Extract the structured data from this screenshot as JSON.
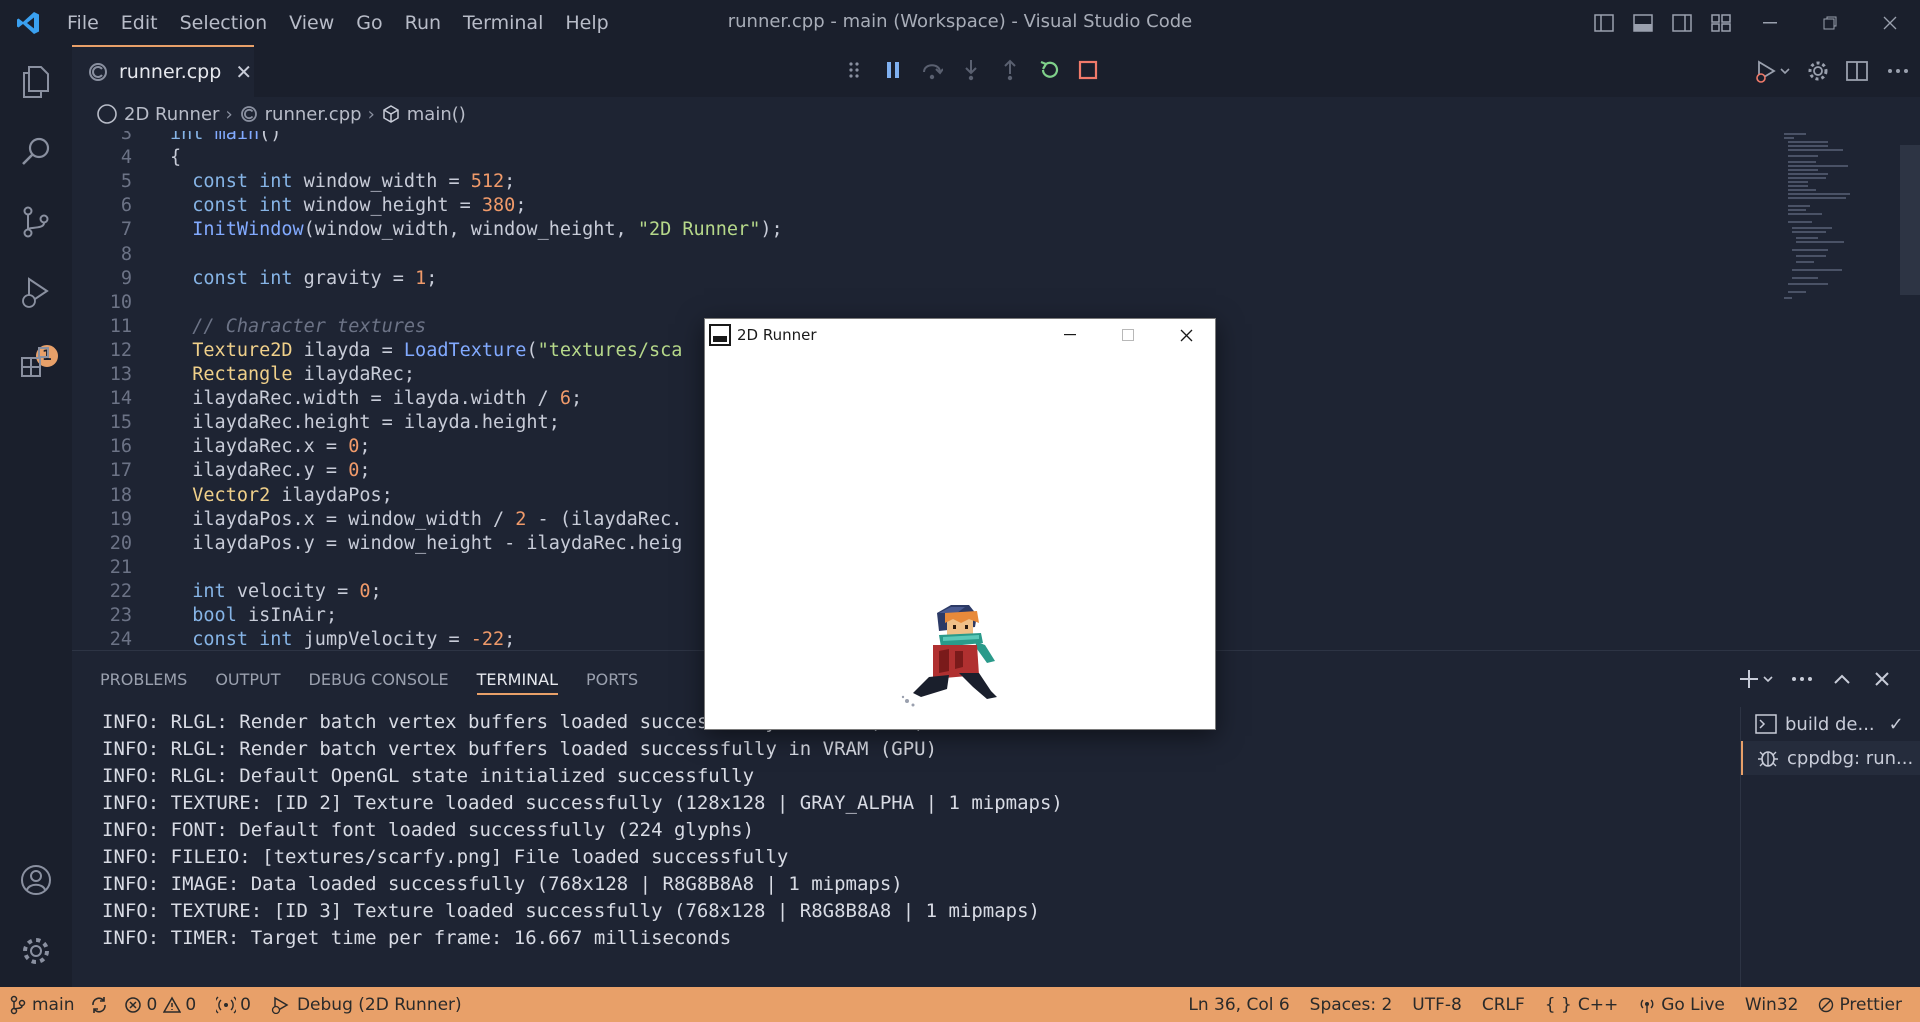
{
  "window_title": "runner.cpp - main (Workspace) - Visual Studio Code",
  "menu": [
    "File",
    "Edit",
    "Selection",
    "View",
    "Go",
    "Run",
    "Terminal",
    "Help"
  ],
  "activity": {
    "debug_badge": "1"
  },
  "tab": {
    "label": "runner.cpp",
    "close": "✕"
  },
  "breadcrumb": {
    "folder": "2D Runner",
    "file": "runner.cpp",
    "symbol": "main()"
  },
  "editor": {
    "lines": [
      {
        "n": "3",
        "parts": [
          [
            "kw",
            "int "
          ],
          [
            "fn",
            "main"
          ],
          [
            "",
            "()"
          ]
        ]
      },
      {
        "n": "4",
        "parts": [
          [
            "",
            "{"
          ]
        ]
      },
      {
        "n": "5",
        "parts": [
          [
            "",
            "  "
          ],
          [
            "kw",
            "const int "
          ],
          [
            "",
            "window_width = "
          ],
          [
            "num",
            "512"
          ],
          [
            "",
            ";"
          ]
        ]
      },
      {
        "n": "6",
        "parts": [
          [
            "",
            "  "
          ],
          [
            "kw",
            "const int "
          ],
          [
            "",
            "window_height = "
          ],
          [
            "num",
            "380"
          ],
          [
            "",
            ";"
          ]
        ]
      },
      {
        "n": "7",
        "parts": [
          [
            "",
            "  "
          ],
          [
            "fn",
            "InitWindow"
          ],
          [
            "",
            "(window_width, window_height, "
          ],
          [
            "str",
            "\"2D Runner\""
          ],
          [
            "",
            ");"
          ]
        ]
      },
      {
        "n": "8",
        "parts": []
      },
      {
        "n": "9",
        "parts": [
          [
            "",
            "  "
          ],
          [
            "kw",
            "const int "
          ],
          [
            "",
            "gravity = "
          ],
          [
            "num",
            "1"
          ],
          [
            "",
            ";"
          ]
        ]
      },
      {
        "n": "10",
        "parts": []
      },
      {
        "n": "11",
        "parts": [
          [
            "",
            "  "
          ],
          [
            "cm",
            "// Character textures"
          ]
        ]
      },
      {
        "n": "12",
        "parts": [
          [
            "",
            "  "
          ],
          [
            "ty",
            "Texture2D "
          ],
          [
            "",
            "ilayda = "
          ],
          [
            "fn",
            "LoadTexture"
          ],
          [
            "",
            "("
          ],
          [
            "str",
            "\"textures/sca"
          ]
        ]
      },
      {
        "n": "13",
        "parts": [
          [
            "",
            "  "
          ],
          [
            "ty",
            "Rectangle "
          ],
          [
            "",
            "ilaydaRec;"
          ]
        ]
      },
      {
        "n": "14",
        "parts": [
          [
            "",
            "  ilaydaRec.width = ilayda.width / "
          ],
          [
            "num",
            "6"
          ],
          [
            "",
            ";"
          ]
        ]
      },
      {
        "n": "15",
        "parts": [
          [
            "",
            "  ilaydaRec.height = ilayda.height;"
          ]
        ]
      },
      {
        "n": "16",
        "parts": [
          [
            "",
            "  ilaydaRec.x = "
          ],
          [
            "num",
            "0"
          ],
          [
            "",
            ";"
          ]
        ]
      },
      {
        "n": "17",
        "parts": [
          [
            "",
            "  ilaydaRec.y = "
          ],
          [
            "num",
            "0"
          ],
          [
            "",
            ";"
          ]
        ]
      },
      {
        "n": "18",
        "parts": [
          [
            "",
            "  "
          ],
          [
            "ty",
            "Vector2 "
          ],
          [
            "",
            "ilaydaPos;"
          ]
        ]
      },
      {
        "n": "19",
        "parts": [
          [
            "",
            "  ilaydaPos.x = window_width / "
          ],
          [
            "num",
            "2"
          ],
          [
            "",
            " - (ilaydaRec."
          ]
        ]
      },
      {
        "n": "20",
        "parts": [
          [
            "",
            "  ilaydaPos.y = window_height - ilaydaRec.heig"
          ]
        ]
      },
      {
        "n": "21",
        "parts": []
      },
      {
        "n": "22",
        "parts": [
          [
            "",
            "  "
          ],
          [
            "kw",
            "int "
          ],
          [
            "",
            "velocity = "
          ],
          [
            "num",
            "0"
          ],
          [
            "",
            ";"
          ]
        ]
      },
      {
        "n": "23",
        "parts": [
          [
            "",
            "  "
          ],
          [
            "kw",
            "bool "
          ],
          [
            "",
            "isInAir;"
          ]
        ]
      },
      {
        "n": "24",
        "parts": [
          [
            "",
            "  "
          ],
          [
            "kw",
            "const int "
          ],
          [
            "",
            "jumpVelocity = "
          ],
          [
            "num",
            "-22"
          ],
          [
            "",
            ";"
          ]
        ]
      }
    ]
  },
  "panel": {
    "tabs": [
      "PROBLEMS",
      "OUTPUT",
      "DEBUG CONSOLE",
      "TERMINAL",
      "PORTS"
    ],
    "active_tab": "TERMINAL",
    "terminal_lines": [
      "INFO: RLGL: Render batch vertex buffers loaded successfully in RAM (CPU)",
      "INFO: RLGL: Render batch vertex buffers loaded successfully in VRAM (GPU)",
      "INFO: RLGL: Default OpenGL state initialized successfully",
      "INFO: TEXTURE: [ID 2] Texture loaded successfully (128x128 | GRAY_ALPHA | 1 mipmaps)",
      "INFO: FONT: Default font loaded successfully (224 glyphs)",
      "INFO: FILEIO: [textures/scarfy.png] File loaded successfully",
      "INFO: IMAGE: Data loaded successfully (768x128 | R8G8B8A8 | 1 mipmaps)",
      "INFO: TEXTURE: [ID 3] Texture loaded successfully (768x128 | R8G8B8A8 | 1 mipmaps)",
      "INFO: TIMER: Target time per frame: 16.667 milliseconds"
    ],
    "terminal_list": [
      {
        "label": "build de...",
        "check": "✓"
      },
      {
        "label": "cppdbg: run..."
      }
    ]
  },
  "statusbar": {
    "branch": "main",
    "errors": "0",
    "warnings": "0",
    "ports": "0",
    "debug": "Debug (2D Runner)",
    "position": "Ln 36, Col 6",
    "spaces": "Spaces: 2",
    "encoding": "UTF-8",
    "eol": "CRLF",
    "language": "C++",
    "golive": "Go Live",
    "platform": "Win32",
    "prettier": "Prettier"
  },
  "game_window": {
    "title": "2D Runner"
  },
  "colors": {
    "accent": "#e8a069",
    "bg": "#1e2433",
    "chrome": "#1a1f2c"
  }
}
